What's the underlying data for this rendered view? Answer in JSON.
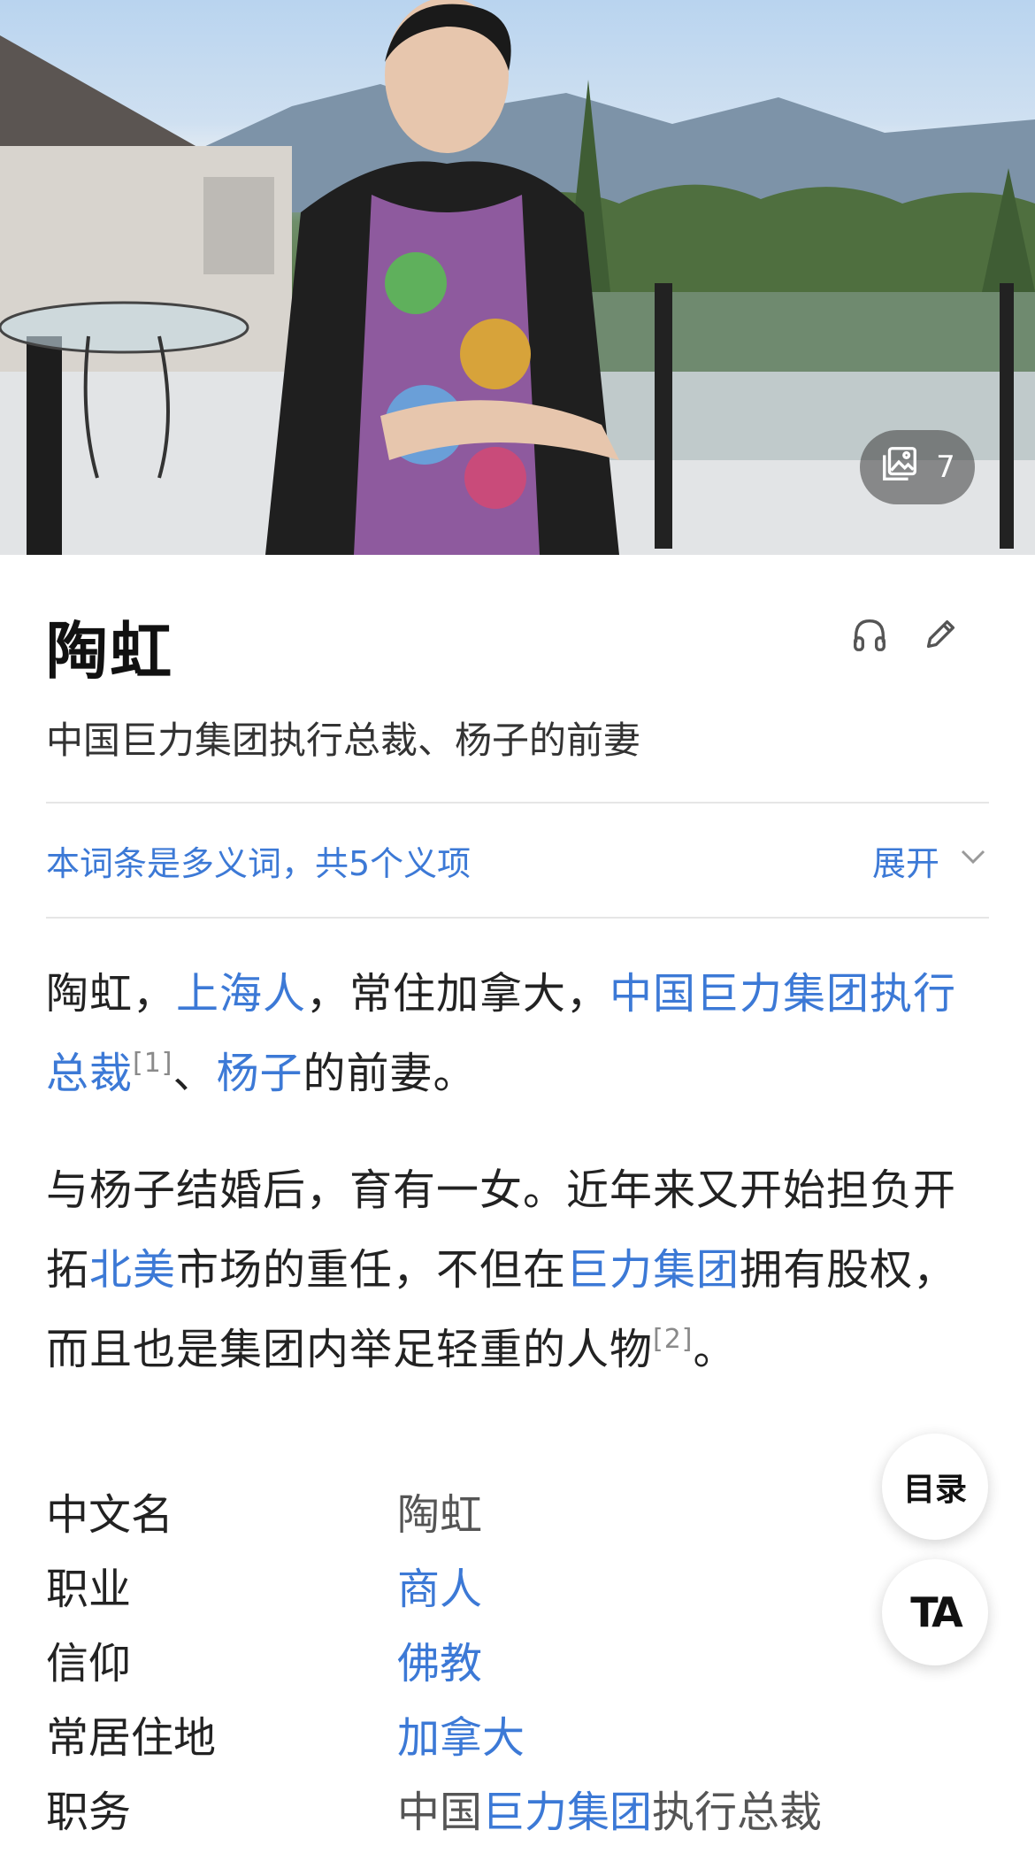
{
  "hero": {
    "gallery_count": "7"
  },
  "header": {
    "title": "陶虹",
    "subtitle": "中国巨力集团执行总裁、杨子的前妻"
  },
  "polysemy": {
    "text": "本词条是多义词，共5个义项",
    "expand_label": "展开"
  },
  "summary": {
    "p1": {
      "t1": "陶虹，",
      "link1": "上海人",
      "t2": "，常住加拿大，",
      "link2": "中国巨力集团执行总裁",
      "ref1": "[1]",
      "t3": "、",
      "link3": "杨子",
      "t4": "的前妻。"
    },
    "p2": {
      "t1": "与杨子结婚后，育有一女。近年来又开始担负开拓",
      "link1": "北美",
      "t2": "市场的重任，不但在",
      "link2": "巨力集团",
      "t3": "拥有股权，而且也是集团内举足轻重的人物",
      "ref2": "[2]",
      "t4": "。"
    }
  },
  "infobox": [
    {
      "key": "中文名",
      "value": "陶虹",
      "is_link": false
    },
    {
      "key": "职业",
      "value": "商人",
      "is_link": true
    },
    {
      "key": "信仰",
      "value": "佛教",
      "is_link": true
    },
    {
      "key": "常居住地",
      "value": "加拿大",
      "is_link": true
    },
    {
      "key": "职务",
      "value_prefix": "中国",
      "value_link": "巨力集团",
      "value_suffix": "执行总裁"
    }
  ],
  "floating": {
    "toc_label": "目录",
    "ta_label": "TA"
  },
  "colors": {
    "link": "#3c79d6",
    "text": "#222222",
    "muted": "#555555",
    "divider": "#e6e6e6"
  },
  "icons": [
    "gallery-icon",
    "headphones-icon",
    "pencil-icon",
    "chevron-down-icon"
  ]
}
